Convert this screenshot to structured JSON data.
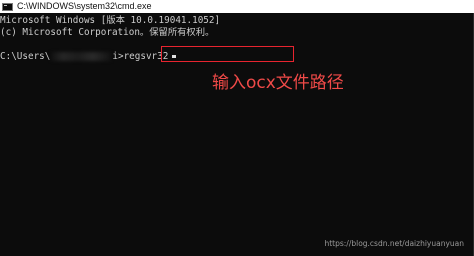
{
  "window": {
    "title": "C:\\WINDOWS\\system32\\cmd.exe",
    "icon": "cmd-icon"
  },
  "console": {
    "line1": "Microsoft Windows [版本 10.0.19041.1052]",
    "line2": "(c) Microsoft Corporation。保留所有权利。",
    "prompt_prefix": "C:\\Users\\",
    "prompt_suffix": "i>regsvr32"
  },
  "annotation": {
    "text": "输入ocx文件路径",
    "color": "#f04a48"
  },
  "watermark": {
    "text": "https://blog.csdn.net/daizhiyuanyuan"
  },
  "colors": {
    "console_bg": "#0c0c0c",
    "console_text": "#cccccc",
    "highlight_border": "#e8242f"
  }
}
